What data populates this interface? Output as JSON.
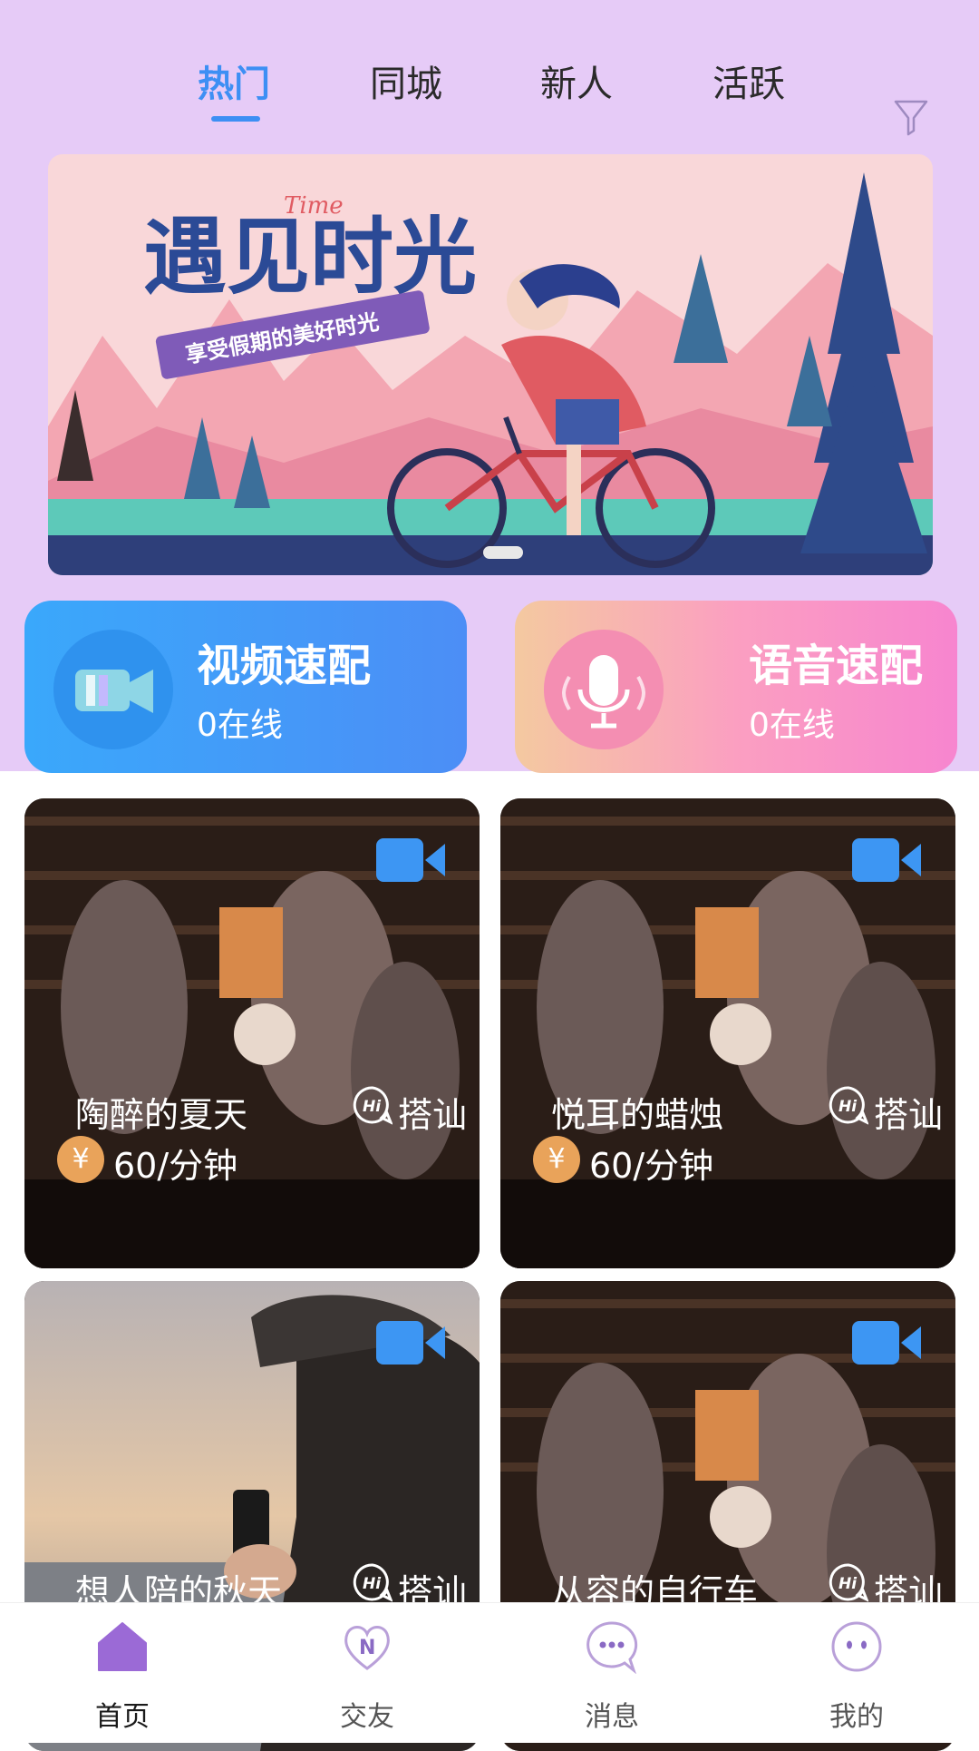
{
  "tabs": [
    {
      "label": "热门",
      "active": true
    },
    {
      "label": "同城",
      "active": false
    },
    {
      "label": "新人",
      "active": false
    },
    {
      "label": "活跃",
      "active": false
    }
  ],
  "filter_icon": "filter-icon",
  "banner": {
    "title": "遇见时光",
    "title_accent": "Time",
    "slogan": "享受假期的美好时光"
  },
  "match": {
    "video": {
      "title": "视频速配",
      "status": "0在线",
      "icon": "video-camera-icon"
    },
    "voice": {
      "title": "语音速配",
      "status": "0在线",
      "icon": "microphone-icon"
    }
  },
  "users": [
    {
      "name": "陶醉的夏天",
      "action": "搭讪",
      "price": "60/分钟",
      "coin_symbol": "¥"
    },
    {
      "name": "悦耳的蜡烛",
      "action": "搭讪",
      "price": "60/分钟",
      "coin_symbol": "¥"
    },
    {
      "name": "想人陪的秋天",
      "action": "搭讪",
      "price": "",
      "coin_symbol": ""
    },
    {
      "name": "从容的自行车",
      "action": "搭讪",
      "price": "",
      "coin_symbol": ""
    }
  ],
  "nav": [
    {
      "label": "首页",
      "icon": "home-icon",
      "active": true
    },
    {
      "label": "交友",
      "icon": "heart-n-icon",
      "active": false
    },
    {
      "label": "消息",
      "icon": "chat-bubble-icon",
      "active": false
    },
    {
      "label": "我的",
      "icon": "face-icon",
      "active": false
    }
  ],
  "colors": {
    "accent": "#3d8ff4",
    "top_background": "#e6cbf7",
    "nav_accent": "#9b6ad6"
  }
}
